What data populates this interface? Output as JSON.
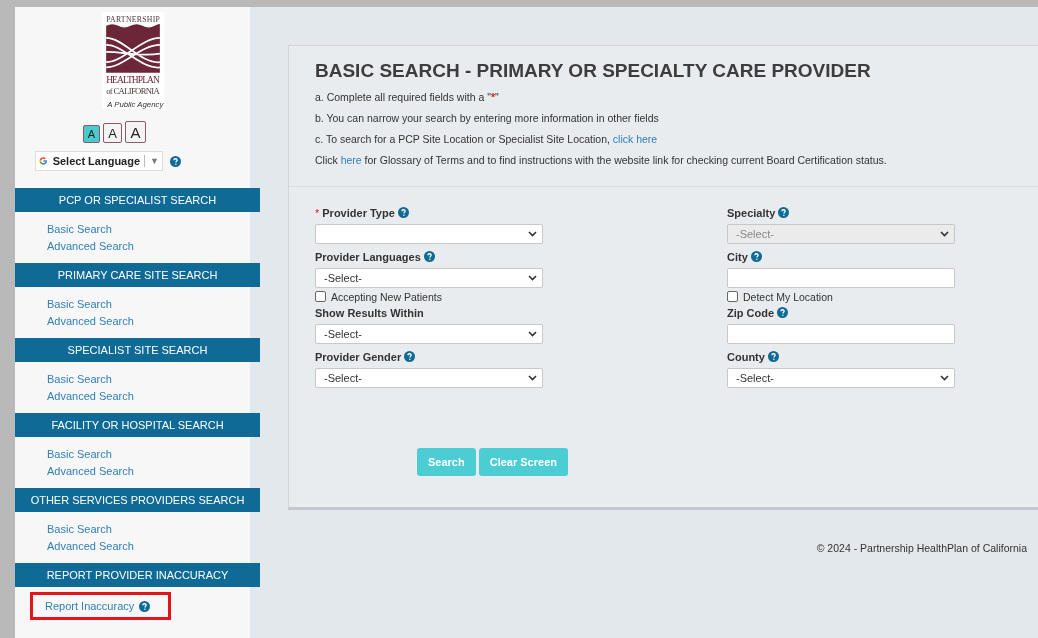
{
  "logo": {
    "top": "PARTNERSHIP",
    "middle": "HEALTHPLAN",
    "bottom": "of CALIFORNIA",
    "tagline": "A Public Agency"
  },
  "font_sizes": [
    {
      "label": "A",
      "selected": true
    },
    {
      "label": "A",
      "selected": false
    },
    {
      "label": "A",
      "selected": false
    }
  ],
  "language": {
    "label": "Select Language",
    "arrow": "▼"
  },
  "sidebar": [
    {
      "title": "PCP OR SPECIALIST SEARCH",
      "links": [
        {
          "label": "Basic Search"
        },
        {
          "label": "Advanced Search"
        }
      ]
    },
    {
      "title": "PRIMARY CARE SITE SEARCH",
      "links": [
        {
          "label": "Basic Search"
        },
        {
          "label": "Advanced Search"
        }
      ]
    },
    {
      "title": "SPECIALIST SITE SEARCH",
      "links": [
        {
          "label": "Basic Search"
        },
        {
          "label": "Advanced Search"
        }
      ]
    },
    {
      "title": "FACILITY OR HOSPITAL SEARCH",
      "links": [
        {
          "label": "Basic Search"
        },
        {
          "label": "Advanced Search"
        }
      ]
    },
    {
      "title": "OTHER SERVICES PROVIDERS SEARCH",
      "links": [
        {
          "label": "Basic Search"
        },
        {
          "label": "Advanced Search"
        }
      ]
    },
    {
      "title": "REPORT PROVIDER INACCURACY",
      "links": [
        {
          "label": "Report Inaccuracy",
          "help": true,
          "highlighted": true
        }
      ]
    }
  ],
  "title": "BASIC SEARCH - PRIMARY OR SPECIALTY CARE PROVIDER",
  "instructions": [
    {
      "text": "a. Complete all required fields with a \"",
      "mark": "*",
      "after": "\""
    },
    {
      "text": "b. You can narrow your search by entering more information in other fields"
    },
    {
      "text": "c. To search for a PCP Site Location or Specialist Site Location, ",
      "link": "click here"
    },
    {
      "text": "Click ",
      "link": "here",
      "after": " for Glossary of Terms and to find instructions with the website link for checking current Board Certification status."
    }
  ],
  "form": {
    "left": [
      {
        "kind": "select",
        "label": "Provider Type",
        "required": true,
        "help": true,
        "disabled": false
      },
      {
        "kind": "select",
        "label": "Provider Languages",
        "required": false,
        "help": true,
        "value": "-Select-",
        "disabled": false
      },
      {
        "kind": "checkbox",
        "label": "Accepting New Patients",
        "checked": false
      },
      {
        "kind": "select",
        "label": "Show Results Within",
        "required": false,
        "help": false,
        "value": "-Select-",
        "disabled": false
      },
      {
        "kind": "select",
        "label": "Provider Gender",
        "required": false,
        "help": true,
        "value": "-Select-",
        "disabled": false
      }
    ],
    "right": [
      {
        "kind": "select",
        "label": "Specialty",
        "required": false,
        "help": true,
        "value": "-Select-",
        "disabled": true
      },
      {
        "kind": "text",
        "label": "City",
        "required": false,
        "help": true
      },
      {
        "kind": "checkbox",
        "label": "Detect My Location",
        "checked": false
      },
      {
        "kind": "text",
        "label": "Zip Code",
        "required": false,
        "help": true
      },
      {
        "kind": "select",
        "label": "County",
        "required": false,
        "help": true,
        "value": "-Select-",
        "disabled": false
      }
    ]
  },
  "buttons": [
    "Search",
    "Clear Screen"
  ],
  "footer": "© 2024 - Partnership HealthPlan of California"
}
